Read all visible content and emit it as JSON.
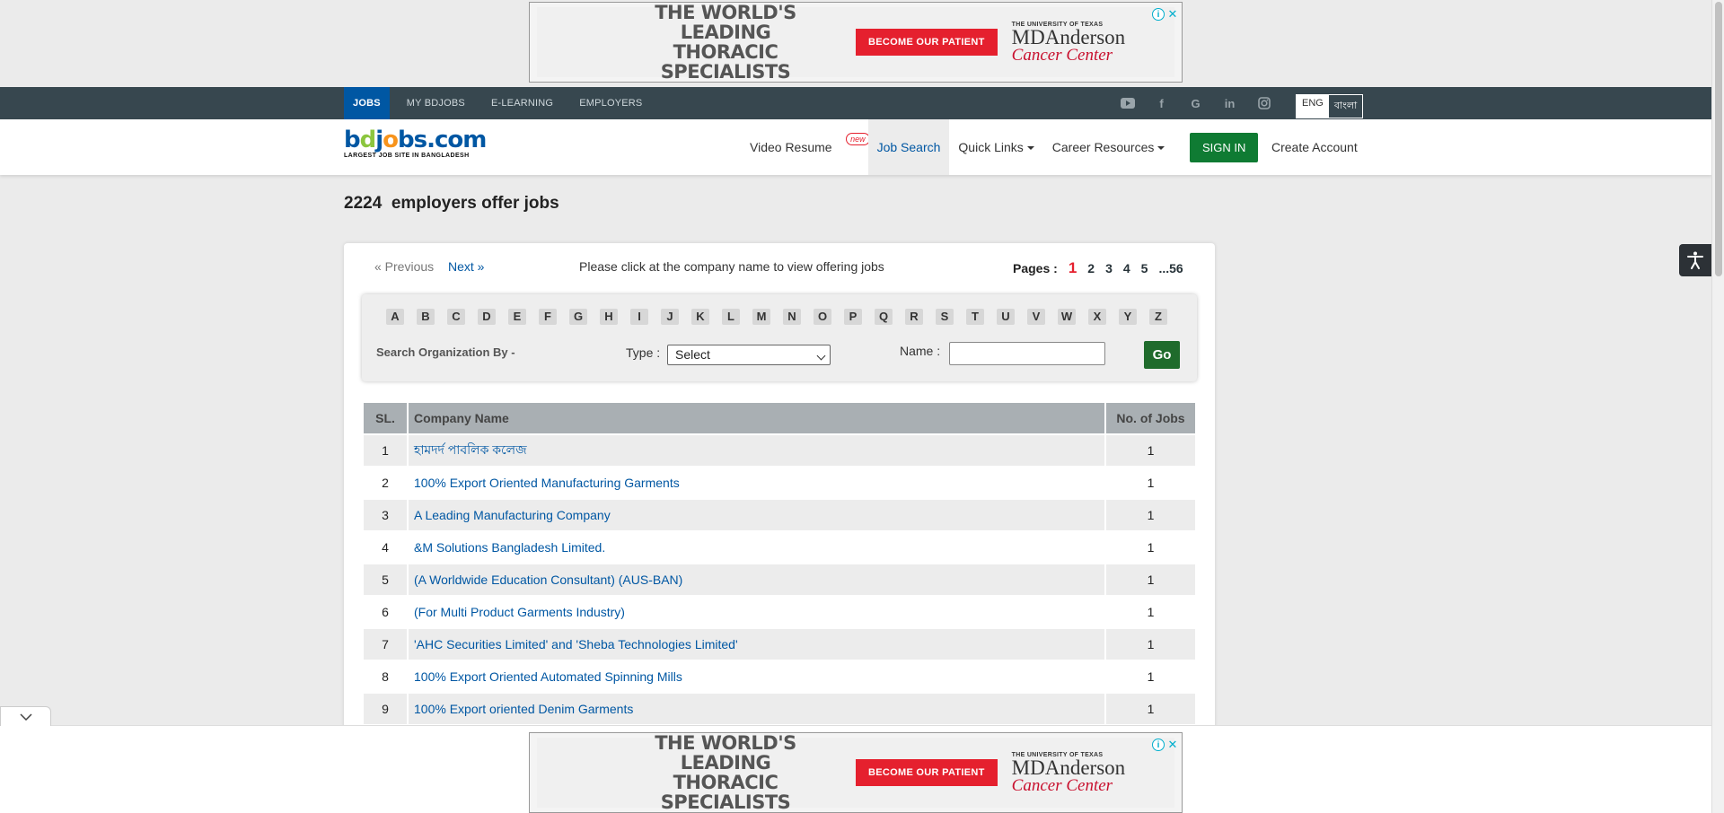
{
  "ad": {
    "headline": "THE WORLD'S LEADING THORACIC SPECIALISTS",
    "cta": "BECOME OUR PATIENT",
    "brand_small": "THE UNIVERSITY OF TEXAS",
    "brand_main": "MDAnderson",
    "brand_sub": "Cancer Center"
  },
  "topnav": {
    "items": [
      "JOBS",
      "MY BDJOBS",
      "E-LEARNING",
      "EMPLOYERS"
    ],
    "active": "JOBS",
    "lang_en": "ENG",
    "lang_bn": "বাংলা",
    "social_icons": [
      "youtube-icon",
      "facebook-icon",
      "google-icon",
      "linkedin-icon",
      "instagram-icon"
    ]
  },
  "header": {
    "logo_text": "bdjobs.com",
    "logo_tagline": "LARGEST JOB SITE IN BANGLADESH",
    "video_resume": "Video Resume",
    "new_badge": "new",
    "job_search": "Job Search",
    "quick_links": "Quick Links",
    "career_resources": "Career Resources",
    "sign_in": "SIGN IN",
    "create_account": "Create Account"
  },
  "main": {
    "title": "2224  employers offer jobs",
    "prev": "« Previous",
    "next": "Next »",
    "hint": "Please click at the company name to view offering jobs",
    "pages_label": "Pages :",
    "pages": [
      "1",
      "2",
      "3",
      "4",
      "5",
      "...56"
    ],
    "current_page": "1"
  },
  "filter": {
    "letters": [
      "A",
      "B",
      "C",
      "D",
      "E",
      "F",
      "G",
      "H",
      "I",
      "J",
      "K",
      "L",
      "M",
      "N",
      "O",
      "P",
      "Q",
      "R",
      "S",
      "T",
      "U",
      "V",
      "W",
      "X",
      "Y",
      "Z"
    ],
    "search_by": "Search Organization By -",
    "type_label": "Type :",
    "type_value": "Select",
    "name_label": "Name :",
    "name_value": "",
    "go": "Go"
  },
  "table": {
    "headers": [
      "SL.",
      "Company Name",
      "No. of Jobs"
    ],
    "rows": [
      {
        "sl": "1",
        "company": "হামদর্দ পাবলিক কলেজ",
        "jobs": "1"
      },
      {
        "sl": "2",
        "company": "100% Export Oriented Manufacturing Garments",
        "jobs": "1"
      },
      {
        "sl": "3",
        "company": "A Leading Manufacturing Company",
        "jobs": "1"
      },
      {
        "sl": "4",
        "company": "&M Solutions Bangladesh Limited.",
        "jobs": "1"
      },
      {
        "sl": "5",
        "company": "(A Worldwide Education Consultant) (AUS-BAN)",
        "jobs": "1"
      },
      {
        "sl": "6",
        "company": "(For Multi Product Garments Industry)",
        "jobs": "1"
      },
      {
        "sl": "7",
        "company": "'AHC Securities Limited' and 'Sheba Technologies Limited'",
        "jobs": "1"
      },
      {
        "sl": "8",
        "company": "100% Export Oriented Automated Spinning Mills",
        "jobs": "1"
      },
      {
        "sl": "9",
        "company": "100% Export oriented Denim Garments",
        "jobs": "1"
      }
    ]
  },
  "colors": {
    "topbar": "#37474f",
    "primary_blue": "#0057a3",
    "signin_green": "#0f7b33",
    "go_green": "#1f6b2c",
    "current_page_red": "#e5202e"
  }
}
